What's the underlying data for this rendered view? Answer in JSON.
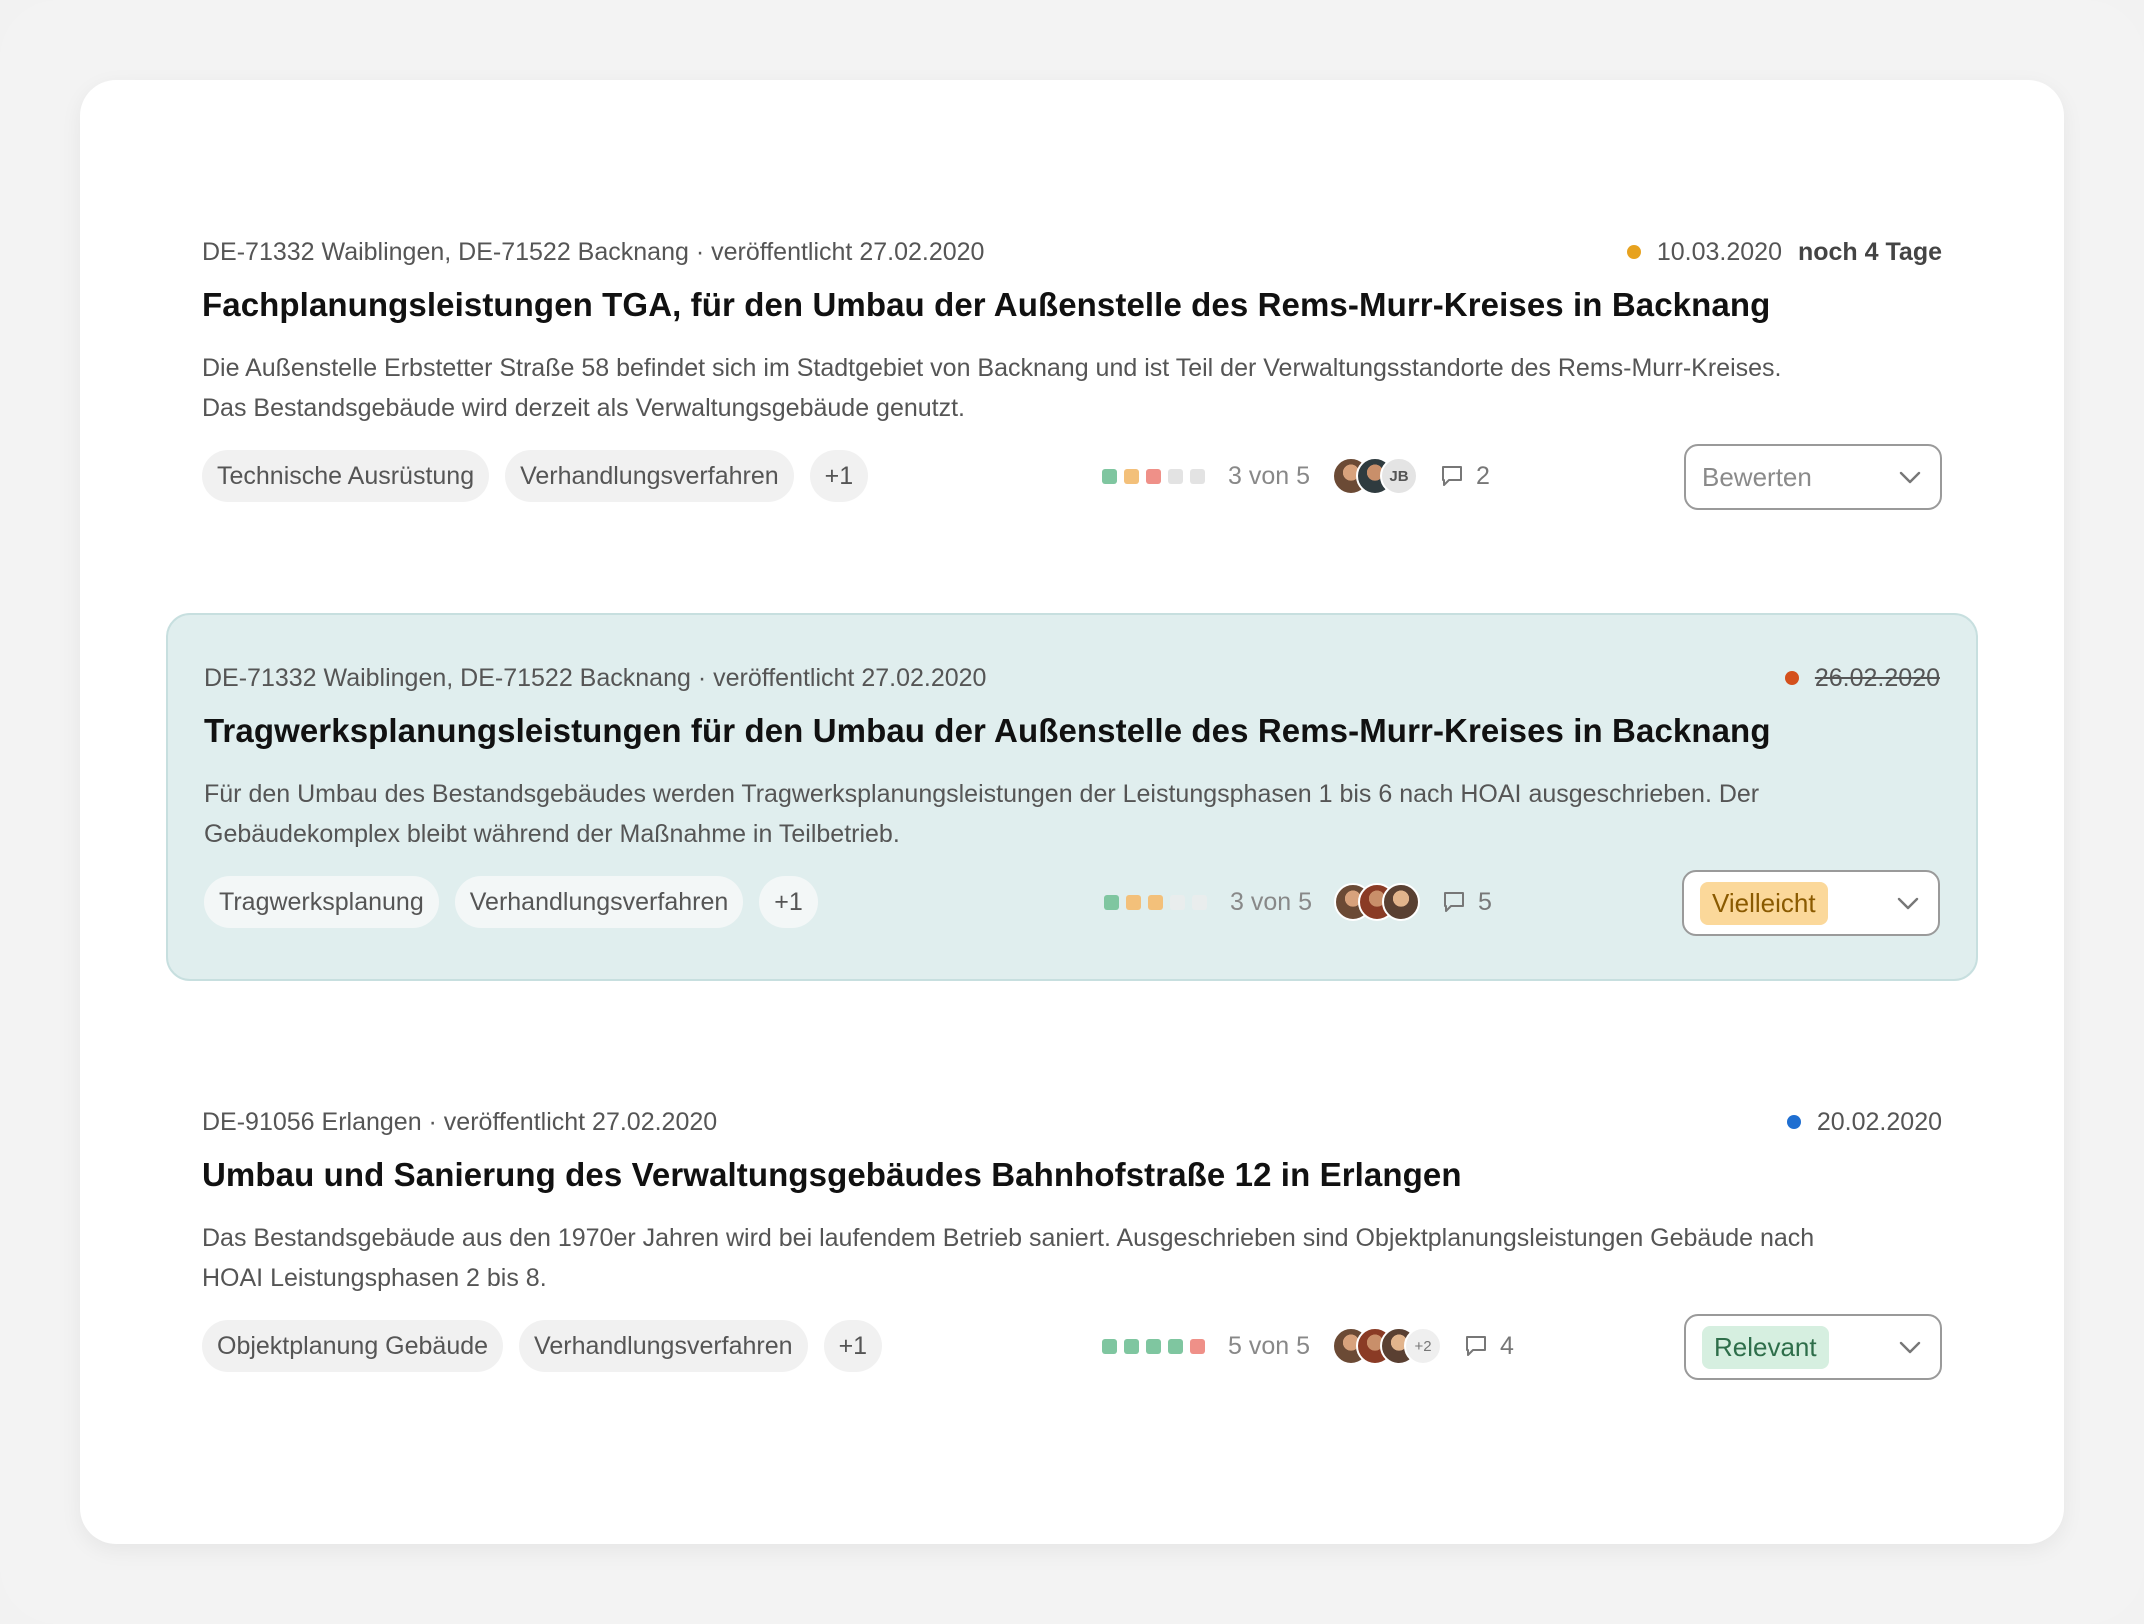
{
  "colors": {
    "green": "#7fc6a0",
    "yellow": "#f3c07a",
    "red": "#ef9088",
    "empty": "#e3e3e3",
    "deadline_orange": "#e7a21f",
    "deadline_red": "#d4501c",
    "deadline_blue": "#1f6fd1",
    "highlight_bg": "#e0eeee",
    "vielleicht_bg": "#fbd89a",
    "vielleicht_fg": "#8a5a00",
    "relevant_bg": "#d6efe0",
    "relevant_fg": "#2e6e4a"
  },
  "items": [
    {
      "location": "DE-71332 Waiblingen, DE-71522 Backnang · veröffentlicht 27.02.2020",
      "deadline": "10.03.2020",
      "remaining": "noch 4 Tage",
      "title": "Fachplanungsleistungen TGA, für den Umbau der Außenstelle des Rems-Murr-Kreises in Backnang",
      "description_line1": "Die Außenstelle Erbstetter Straße 58 befindet sich im Stadtgebiet von Backnang und ist Teil der Verwaltungsstandorte des Rems-Murr-Kreises.",
      "description_line2": "Das Bestandsgebäude wird derzeit als Verwaltungsgebäude genutzt.",
      "tags": [
        "Technische Ausrüstung",
        "Verhandlungsverfahren",
        "+1"
      ],
      "rating": 3,
      "rating_max": 5,
      "rating_text": "3 von 5",
      "avatar_initials": "JB",
      "comments": "2",
      "select_value": "Bewerten"
    },
    {
      "location": "DE-71332 Waiblingen, DE-71522 Backnang · veröffentlicht 27.02.2020",
      "deadline": "26.02.2020",
      "title": "Tragwerksplanungsleistungen für den Umbau der Außenstelle des Rems-Murr-Kreises in Backnang",
      "description_line1": "Für den Umbau des Bestandsgebäudes werden Tragwerksplanungsleistungen der Leistungsphasen 1 bis 6 nach HOAI ausgeschrieben. Der",
      "description_line2": "Gebäudekomplex bleibt während der Maßnahme in Teilbetrieb.",
      "tags": [
        "Tragwerksplanung",
        "Verhandlungsverfahren",
        "+1"
      ],
      "rating": 3,
      "rating_max": 5,
      "rating_text": "3 von 5",
      "comments": "5",
      "select_value": "Vielleicht"
    },
    {
      "location": "DE-91056 Erlangen · veröffentlicht 27.02.2020",
      "deadline": "20.02.2020",
      "title": "Umbau und Sanierung des Verwaltungsgebäudes Bahnhofstraße 12 in Erlangen",
      "description_line1": "Das Bestandsgebäude aus den 1970er Jahren wird bei laufendem Betrieb saniert. Ausgeschrieben sind Objektplanungsleistungen Gebäude nach",
      "description_line2": "HOAI Leistungsphasen 2 bis 8.",
      "tags": [
        "Objektplanung Gebäude",
        "Verhandlungsverfahren",
        "+1"
      ],
      "rating": 5,
      "rating_max": 5,
      "rating_text": "5 von 5",
      "avatar_more": "+2",
      "comments": "4",
      "select_value": "Relevant"
    }
  ]
}
